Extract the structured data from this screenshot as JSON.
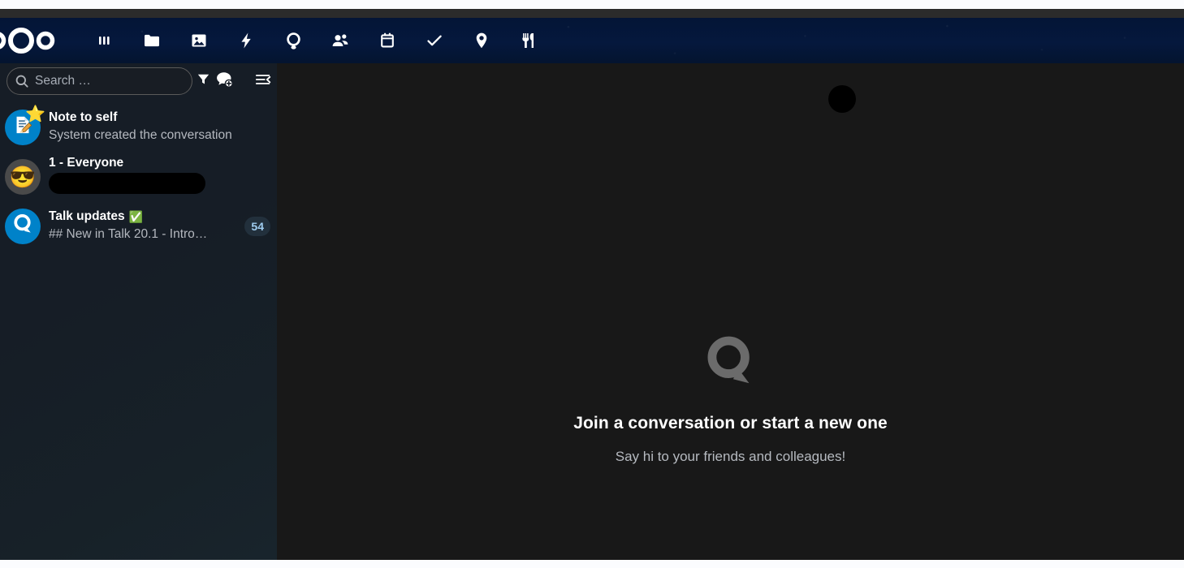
{
  "app": {
    "name": "Nextcloud Talk",
    "logo_icon": "nextcloud-logo"
  },
  "topnav": {
    "items": [
      {
        "label": "Dashboard",
        "icon": "dashboard-icon"
      },
      {
        "label": "Files",
        "icon": "folder-icon"
      },
      {
        "label": "Photos",
        "icon": "photos-icon"
      },
      {
        "label": "Activity",
        "icon": "lightning-icon"
      },
      {
        "label": "Talk",
        "icon": "talk-icon"
      },
      {
        "label": "Contacts",
        "icon": "contacts-icon"
      },
      {
        "label": "Calendar",
        "icon": "calendar-icon"
      },
      {
        "label": "Tasks",
        "icon": "check-icon"
      },
      {
        "label": "Maps",
        "icon": "map-pin-icon"
      },
      {
        "label": "Cookbook",
        "icon": "cutlery-icon"
      }
    ]
  },
  "sidebar": {
    "search": {
      "placeholder": "Search …",
      "value": "",
      "icon": "search-icon"
    },
    "actions": [
      {
        "name": "filter-button",
        "icon": "funnel-icon",
        "label": "Filter conversations"
      },
      {
        "name": "new-conversation-button",
        "icon": "chat-plus-icon",
        "label": "New conversation"
      },
      {
        "name": "collapse-sidebar-button",
        "icon": "collapse-sidebar-icon",
        "label": "Collapse sidebar"
      }
    ],
    "conversations": [
      {
        "title": "Note to self",
        "subtitle": "System created the conversation",
        "avatar_icon": "note-pencil-icon",
        "avatar_style": "blue",
        "badge_emoji": "⭐",
        "unread": "",
        "redacted": false,
        "verified": ""
      },
      {
        "title": "1 - Everyone",
        "subtitle": "",
        "avatar_icon": "sunglasses-emoji",
        "avatar_emoji": "😎",
        "avatar_style": "gray",
        "badge_emoji": "",
        "unread": "",
        "redacted": true,
        "verified": ""
      },
      {
        "title": "Talk updates",
        "subtitle": "## New in Talk 20.1 - Intro…",
        "avatar_icon": "talk-logo-icon",
        "avatar_style": "blue",
        "badge_emoji": "",
        "unread": "54",
        "redacted": false,
        "verified": "✅"
      }
    ]
  },
  "main": {
    "empty_state": {
      "logo_icon": "talk-logo-large-icon",
      "title": "Join a conversation or start a new one",
      "subtitle": "Say hi to your friends and colleagues!"
    }
  },
  "colors": {
    "topbar_bg": "#04163a",
    "sidebar_bg": "#161d26",
    "main_bg": "#181818",
    "accent_blue": "#0082c9",
    "badge_bg": "#22303c",
    "badge_text": "#9fcdf0",
    "text_primary": "#ffffff",
    "text_secondary": "#b4b8bf"
  }
}
